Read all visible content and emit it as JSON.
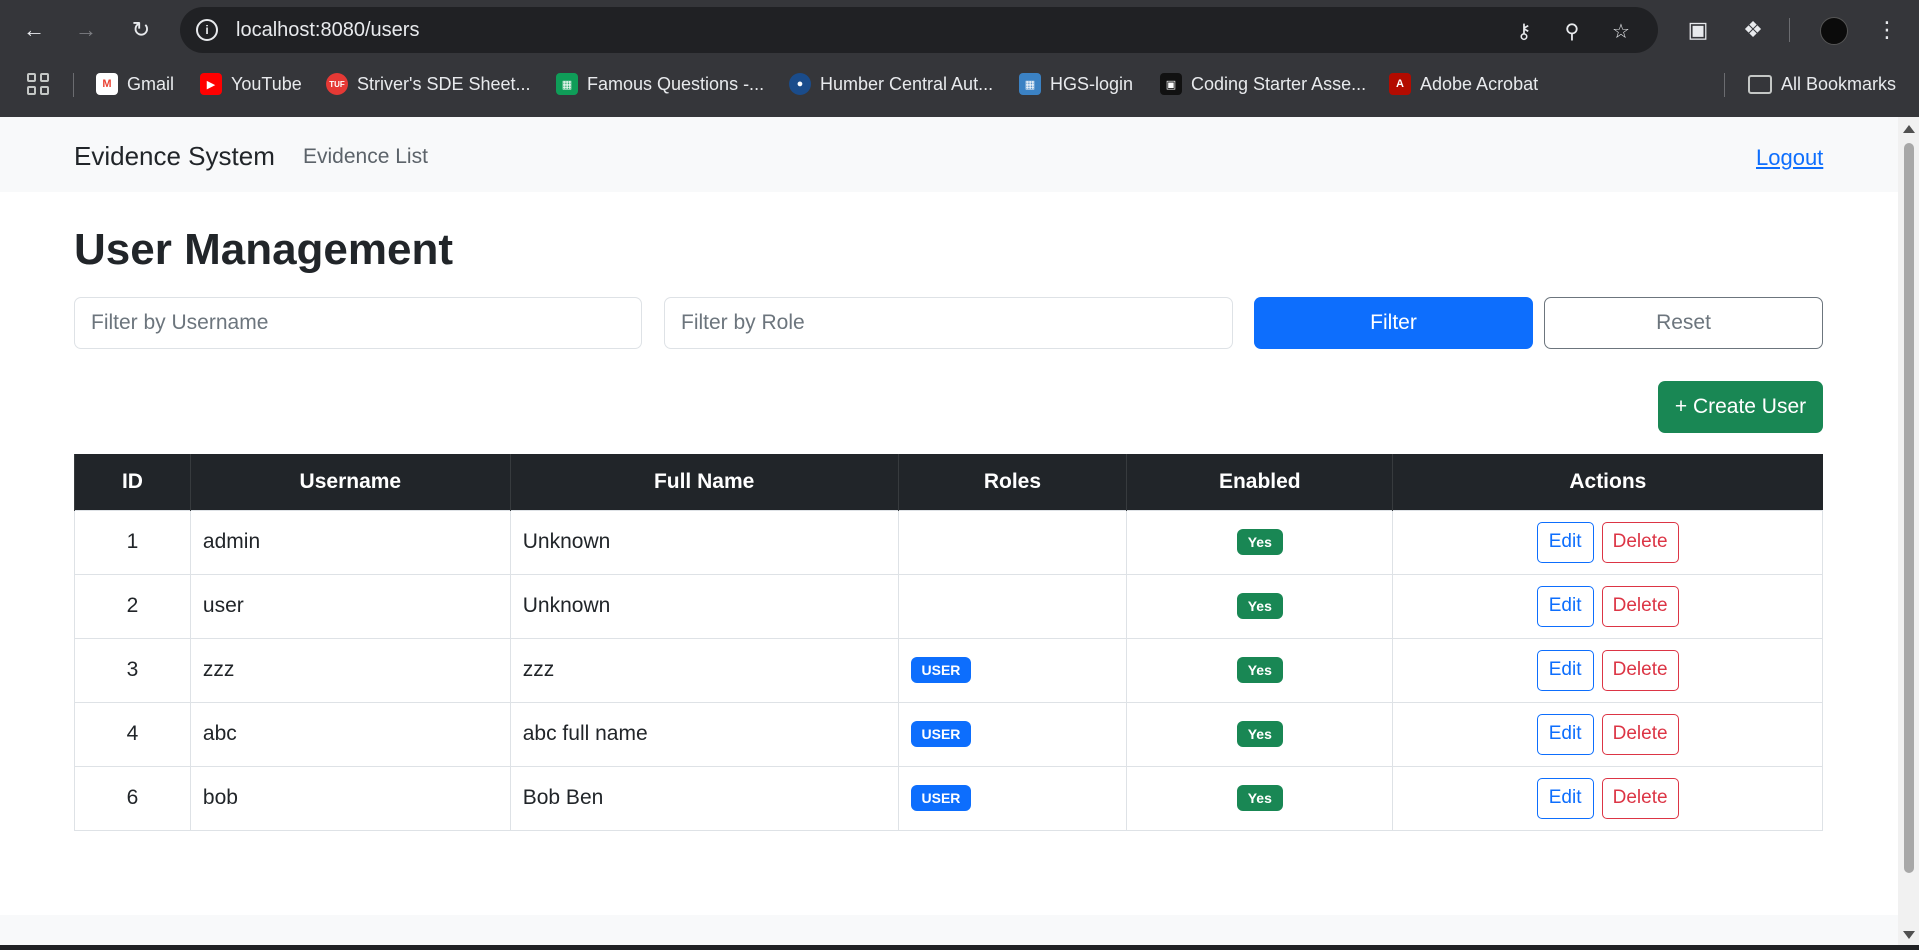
{
  "browser": {
    "url": "localhost:8080/users",
    "bookmarks": [
      {
        "label": "Gmail",
        "icon": "gmail-icon",
        "color": "#ea4335"
      },
      {
        "label": "YouTube",
        "icon": "youtube-icon",
        "color": "#ff0000"
      },
      {
        "label": "Striver's SDE Sheet...",
        "icon": "tuf-icon",
        "color": "#e53935"
      },
      {
        "label": "Famous Questions -...",
        "icon": "sheets-icon",
        "color": "#0f9d58"
      },
      {
        "label": "Humber Central Aut...",
        "icon": "humber-icon",
        "color": "#1a4c8b"
      },
      {
        "label": "HGS-login",
        "icon": "hgs-icon",
        "color": "#3b82c4"
      },
      {
        "label": "Coding Starter Asse...",
        "icon": "coding-icon",
        "color": "#111111"
      },
      {
        "label": "Adobe Acrobat",
        "icon": "acrobat-icon",
        "color": "#b30b00"
      }
    ],
    "all_bookmarks": "All Bookmarks"
  },
  "navbar": {
    "brand": "Evidence System",
    "link": "Evidence List",
    "logout": "Logout"
  },
  "page": {
    "title": "User Management"
  },
  "filters": {
    "username_placeholder": "Filter by Username",
    "role_placeholder": "Filter by Role",
    "filter_label": "Filter",
    "reset_label": "Reset",
    "create_label": "+ Create User"
  },
  "table": {
    "headers": [
      "ID",
      "Username",
      "Full Name",
      "Roles",
      "Enabled",
      "Actions"
    ],
    "rows": [
      {
        "id": "1",
        "username": "admin",
        "full_name": "Unknown",
        "roles": "",
        "enabled": "Yes"
      },
      {
        "id": "2",
        "username": "user",
        "full_name": "Unknown",
        "roles": "",
        "enabled": "Yes"
      },
      {
        "id": "3",
        "username": "zzz",
        "full_name": "zzz",
        "roles": "USER",
        "enabled": "Yes"
      },
      {
        "id": "4",
        "username": "abc",
        "full_name": "abc full name",
        "roles": "USER",
        "enabled": "Yes"
      },
      {
        "id": "6",
        "username": "bob",
        "full_name": "Bob Ben",
        "roles": "USER",
        "enabled": "Yes"
      }
    ],
    "edit_label": "Edit",
    "delete_label": "Delete"
  },
  "colors": {
    "primary": "#0d6efd",
    "success": "#198754",
    "danger": "#dc3545",
    "dark": "#212529"
  }
}
